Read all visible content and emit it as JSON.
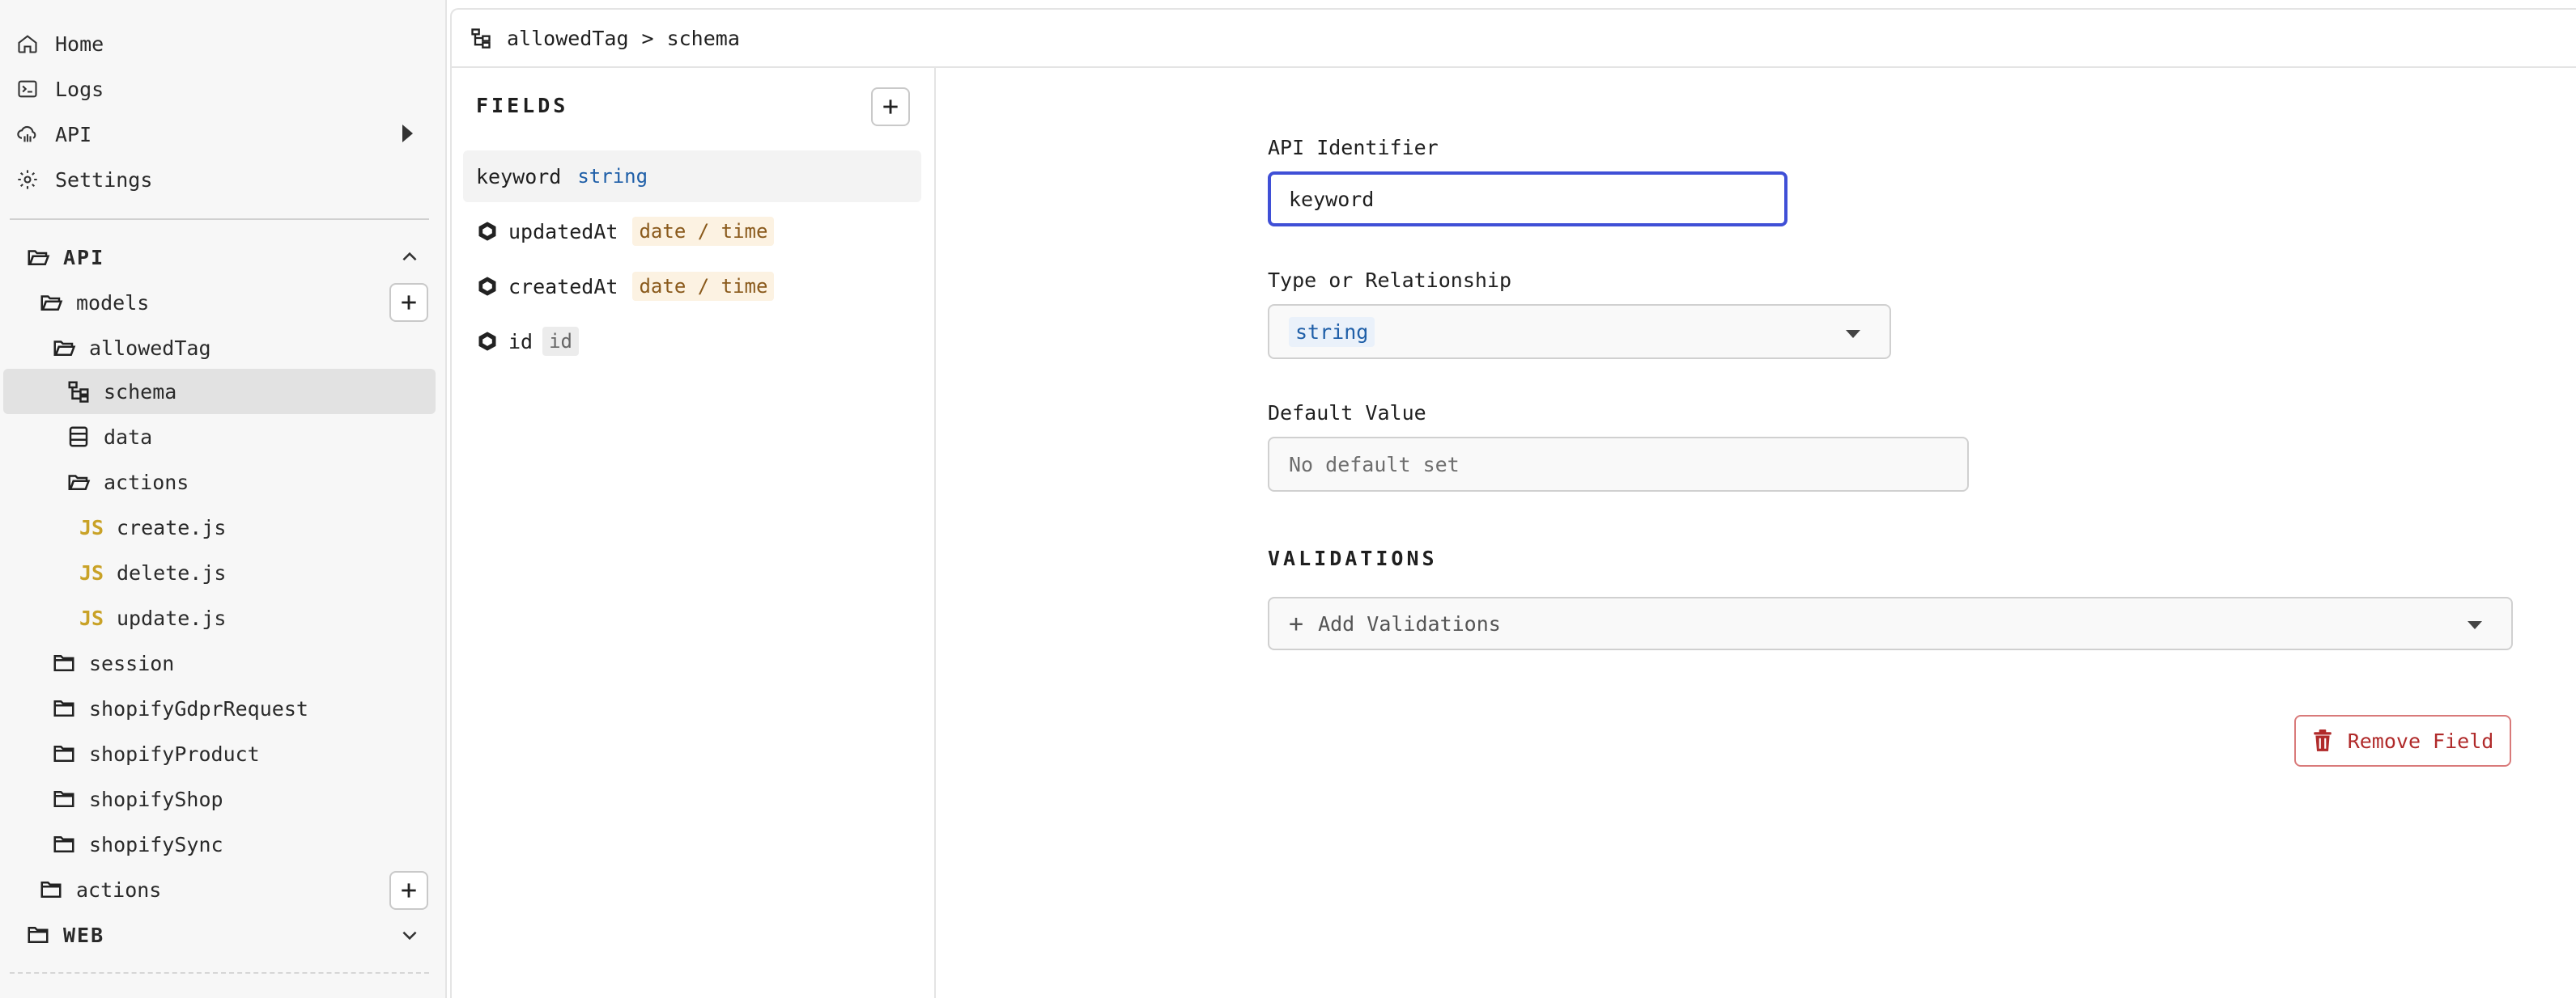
{
  "sidebar": {
    "nav": [
      {
        "label": "Home",
        "icon": "home-icon"
      },
      {
        "label": "Logs",
        "icon": "logs-icon"
      },
      {
        "label": "API",
        "icon": "api-icon"
      },
      {
        "label": "Settings",
        "icon": "gear-icon"
      }
    ],
    "tree": {
      "api_section": "API",
      "models": "models",
      "allowedTag": "allowedTag",
      "schema": "schema",
      "data": "data",
      "actions_inner": "actions",
      "files": [
        "create.js",
        "delete.js",
        "update.js"
      ],
      "js_badge": "JS",
      "models_list": [
        "session",
        "shopifyGdprRequest",
        "shopifyProduct",
        "shopifyShop",
        "shopifySync"
      ],
      "actions": "actions",
      "web_section": "WEB"
    }
  },
  "header": {
    "breadcrumb_parent": "allowedTag",
    "breadcrumb_sep": ">",
    "breadcrumb_current": "schema"
  },
  "fields": {
    "title": "FIELDS",
    "items": [
      {
        "name": "keyword",
        "type": "string"
      },
      {
        "name": "updatedAt",
        "type": "date / time"
      },
      {
        "name": "createdAt",
        "type": "date / time"
      },
      {
        "name": "id",
        "type": "id"
      }
    ]
  },
  "form": {
    "api_identifier_label": "API Identifier",
    "api_identifier_value": "keyword",
    "type_label": "Type or Relationship",
    "type_value": "string",
    "default_label": "Default Value",
    "default_placeholder": "No default set",
    "validations_title": "VALIDATIONS",
    "add_validations": "Add Validations",
    "add_validations_plus": "+",
    "remove_field": "Remove Field"
  },
  "colors": {
    "focus_border": "#3f4fd6",
    "string_type": "#1f5fa8",
    "date_type": "#8a5a1c",
    "danger": "#b02a2a",
    "js_badge": "#c9a227"
  }
}
